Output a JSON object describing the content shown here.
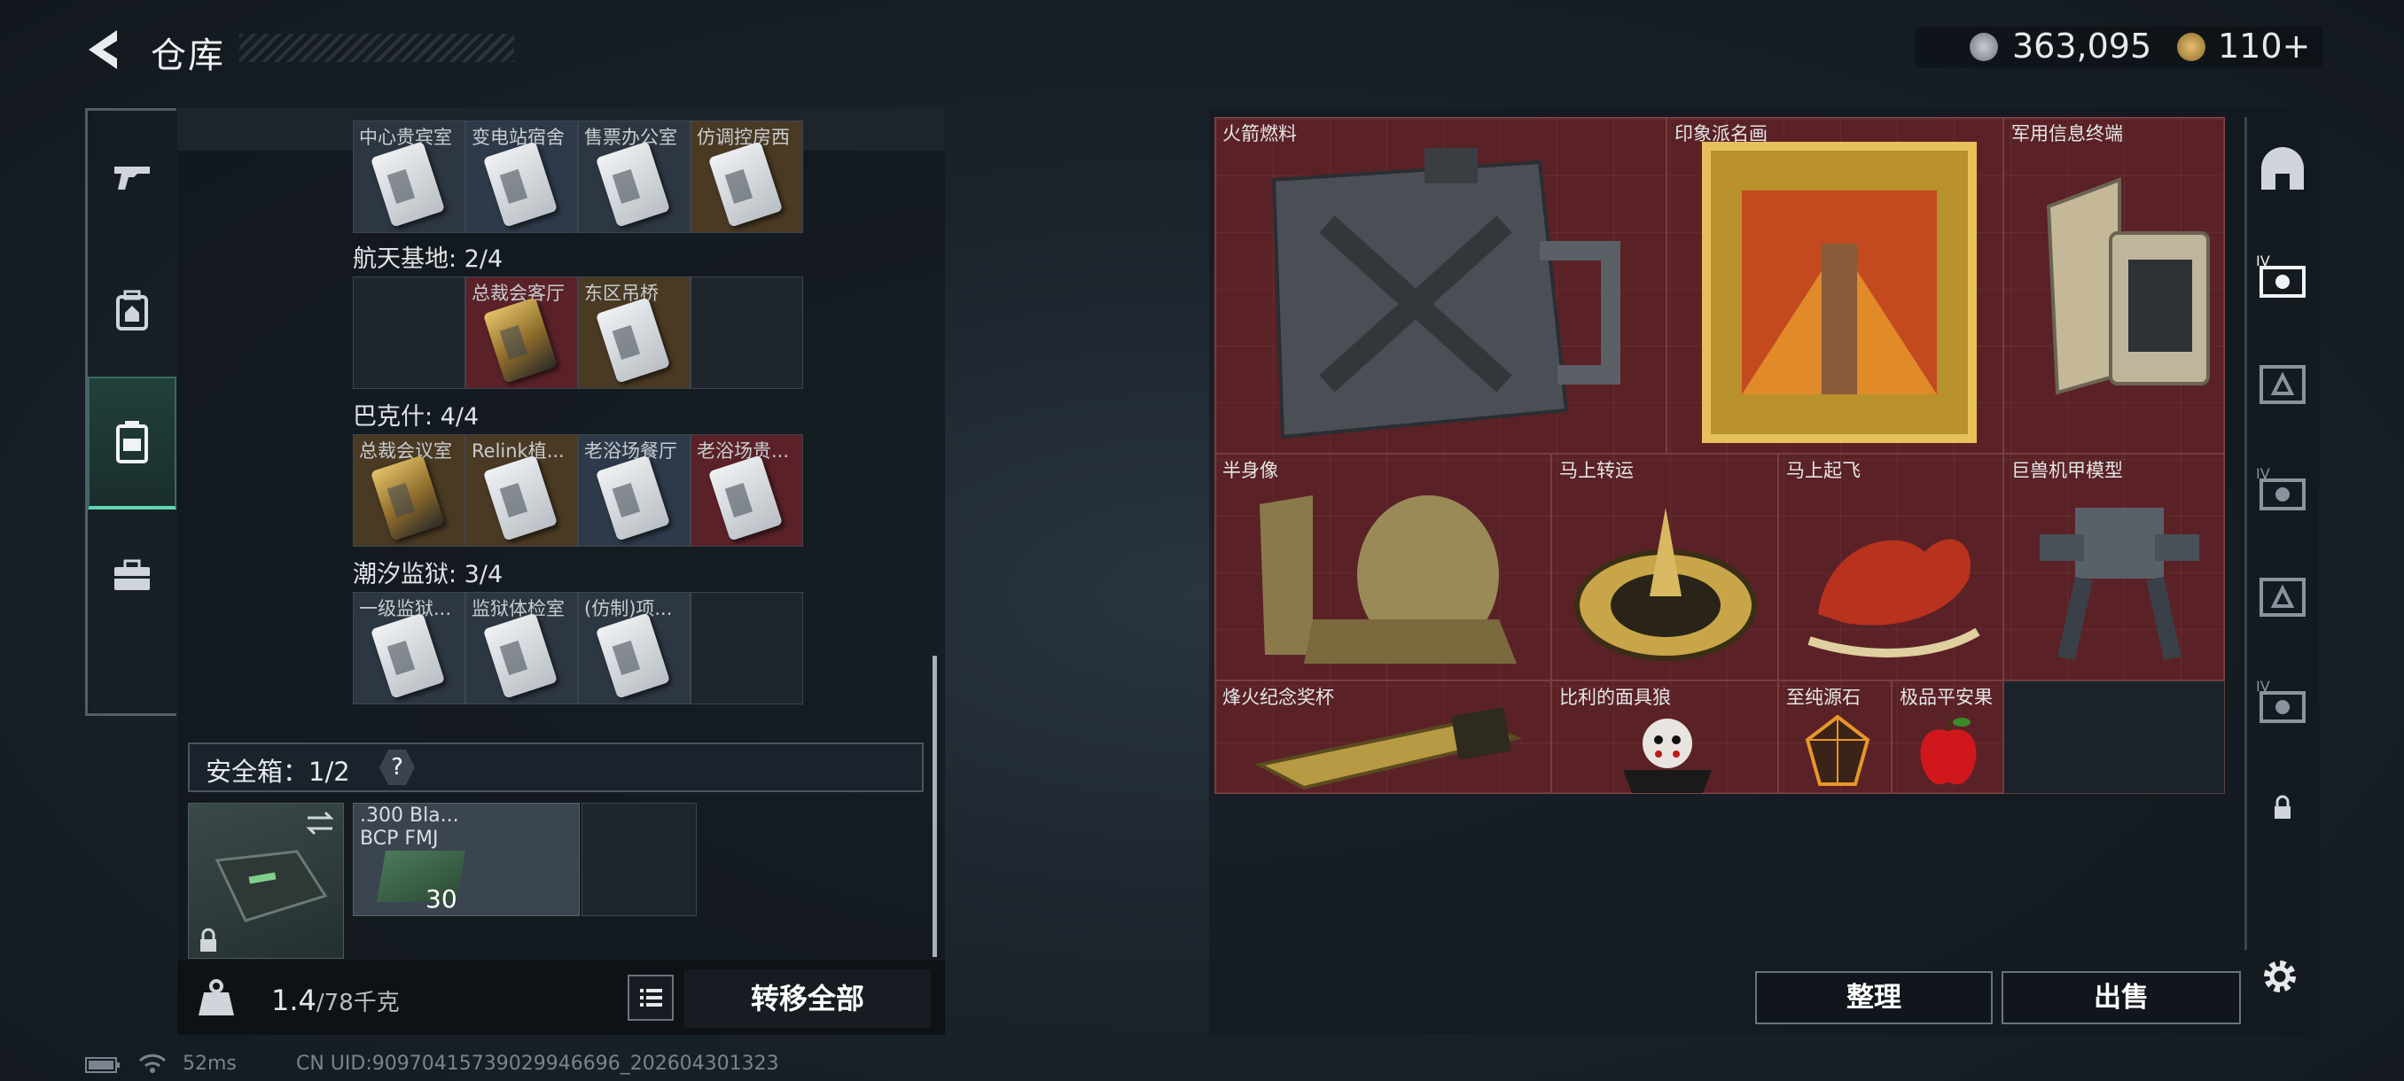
{
  "header": {
    "title": "仓库"
  },
  "currency": [
    {
      "icon": "silver-coin-icon",
      "value": "363,095"
    },
    {
      "icon": "gold-coin-icon",
      "value": "110+"
    }
  ],
  "left_nav": {
    "items": [
      "gun-icon",
      "backpack-icon",
      "vest-icon",
      "toolbox-icon"
    ],
    "active": 2
  },
  "collection": {
    "groups": [
      {
        "label": "",
        "slots": [
          {
            "label": "中心贵宾室",
            "color": "grey"
          },
          {
            "label": "变电站宿舍",
            "color": "blue"
          },
          {
            "label": "售票办公室",
            "color": "grey"
          },
          {
            "label": "仿调控房西",
            "color": "gold"
          }
        ]
      },
      {
        "label": "航天基地: 2/4",
        "slots": [
          {
            "label": "",
            "color": "empty"
          },
          {
            "label": "总裁会客厅",
            "color": "red"
          },
          {
            "label": "东区吊桥",
            "color": "gold"
          },
          {
            "label": "",
            "color": "empty"
          }
        ]
      },
      {
        "label": "巴克什: 4/4",
        "slots": [
          {
            "label": "总裁会议室",
            "color": "gold"
          },
          {
            "label": "Relink植...",
            "color": "gold"
          },
          {
            "label": "老浴场餐厅",
            "color": "blue"
          },
          {
            "label": "老浴场贵...",
            "color": "red"
          }
        ]
      },
      {
        "label": "潮汐监狱: 3/4",
        "slots": [
          {
            "label": "一级监狱...",
            "color": "grey"
          },
          {
            "label": "监狱体检室",
            "color": "grey"
          },
          {
            "label": "(仿制)项...",
            "color": "grey"
          },
          {
            "label": "",
            "color": "empty"
          }
        ]
      }
    ]
  },
  "safebox": {
    "label": "安全箱：1/2",
    "help": "?",
    "ammo": {
      "label": ".300 Bla... BCP FMJ",
      "count": "30"
    }
  },
  "bottom": {
    "weight": "1.4",
    "weight_unit": "/78千克",
    "transfer": "转移全部"
  },
  "stash_items": [
    {
      "id": "fuel",
      "label": "火箭燃料"
    },
    {
      "id": "painting",
      "label": "印象派名画"
    },
    {
      "id": "terminal",
      "label": "军用信息终端"
    },
    {
      "id": "bust",
      "label": "半身像"
    },
    {
      "id": "fortune",
      "label": "马上转运"
    },
    {
      "id": "horse",
      "label": "马上起飞"
    },
    {
      "id": "mech",
      "label": "巨兽机甲模型"
    },
    {
      "id": "trophy",
      "label": "烽火纪念奖杯"
    },
    {
      "id": "mask",
      "label": "比利的面具狼"
    },
    {
      "id": "gem",
      "label": "至纯源石"
    },
    {
      "id": "apple",
      "label": "极品平安果"
    }
  ],
  "right_nav": [
    "bunker-icon",
    "case-iv-icon",
    "case-a-icon",
    "case-iv-icon",
    "case-a-icon",
    "case-iv-icon",
    "lock-icon"
  ],
  "buttons": {
    "sort": "整理",
    "sell": "出售"
  },
  "status": {
    "ping": "52ms",
    "uid": "CN UID:9097041573902994669​6_202604301323"
  }
}
